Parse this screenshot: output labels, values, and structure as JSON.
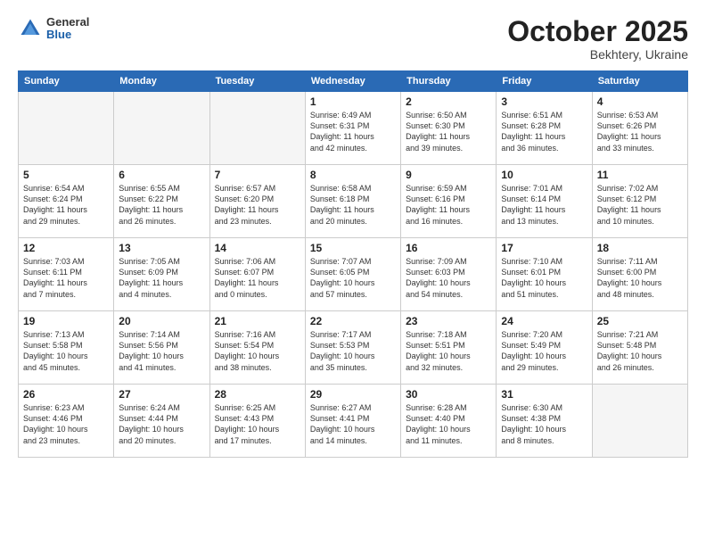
{
  "header": {
    "logo": {
      "general": "General",
      "blue": "Blue"
    },
    "title": "October 2025",
    "location": "Bekhtery, Ukraine"
  },
  "weekdays": [
    "Sunday",
    "Monday",
    "Tuesday",
    "Wednesday",
    "Thursday",
    "Friday",
    "Saturday"
  ],
  "weeks": [
    [
      {
        "day": "",
        "info": ""
      },
      {
        "day": "",
        "info": ""
      },
      {
        "day": "",
        "info": ""
      },
      {
        "day": "1",
        "info": "Sunrise: 6:49 AM\nSunset: 6:31 PM\nDaylight: 11 hours\nand 42 minutes."
      },
      {
        "day": "2",
        "info": "Sunrise: 6:50 AM\nSunset: 6:30 PM\nDaylight: 11 hours\nand 39 minutes."
      },
      {
        "day": "3",
        "info": "Sunrise: 6:51 AM\nSunset: 6:28 PM\nDaylight: 11 hours\nand 36 minutes."
      },
      {
        "day": "4",
        "info": "Sunrise: 6:53 AM\nSunset: 6:26 PM\nDaylight: 11 hours\nand 33 minutes."
      }
    ],
    [
      {
        "day": "5",
        "info": "Sunrise: 6:54 AM\nSunset: 6:24 PM\nDaylight: 11 hours\nand 29 minutes."
      },
      {
        "day": "6",
        "info": "Sunrise: 6:55 AM\nSunset: 6:22 PM\nDaylight: 11 hours\nand 26 minutes."
      },
      {
        "day": "7",
        "info": "Sunrise: 6:57 AM\nSunset: 6:20 PM\nDaylight: 11 hours\nand 23 minutes."
      },
      {
        "day": "8",
        "info": "Sunrise: 6:58 AM\nSunset: 6:18 PM\nDaylight: 11 hours\nand 20 minutes."
      },
      {
        "day": "9",
        "info": "Sunrise: 6:59 AM\nSunset: 6:16 PM\nDaylight: 11 hours\nand 16 minutes."
      },
      {
        "day": "10",
        "info": "Sunrise: 7:01 AM\nSunset: 6:14 PM\nDaylight: 11 hours\nand 13 minutes."
      },
      {
        "day": "11",
        "info": "Sunrise: 7:02 AM\nSunset: 6:12 PM\nDaylight: 11 hours\nand 10 minutes."
      }
    ],
    [
      {
        "day": "12",
        "info": "Sunrise: 7:03 AM\nSunset: 6:11 PM\nDaylight: 11 hours\nand 7 minutes."
      },
      {
        "day": "13",
        "info": "Sunrise: 7:05 AM\nSunset: 6:09 PM\nDaylight: 11 hours\nand 4 minutes."
      },
      {
        "day": "14",
        "info": "Sunrise: 7:06 AM\nSunset: 6:07 PM\nDaylight: 11 hours\nand 0 minutes."
      },
      {
        "day": "15",
        "info": "Sunrise: 7:07 AM\nSunset: 6:05 PM\nDaylight: 10 hours\nand 57 minutes."
      },
      {
        "day": "16",
        "info": "Sunrise: 7:09 AM\nSunset: 6:03 PM\nDaylight: 10 hours\nand 54 minutes."
      },
      {
        "day": "17",
        "info": "Sunrise: 7:10 AM\nSunset: 6:01 PM\nDaylight: 10 hours\nand 51 minutes."
      },
      {
        "day": "18",
        "info": "Sunrise: 7:11 AM\nSunset: 6:00 PM\nDaylight: 10 hours\nand 48 minutes."
      }
    ],
    [
      {
        "day": "19",
        "info": "Sunrise: 7:13 AM\nSunset: 5:58 PM\nDaylight: 10 hours\nand 45 minutes."
      },
      {
        "day": "20",
        "info": "Sunrise: 7:14 AM\nSunset: 5:56 PM\nDaylight: 10 hours\nand 41 minutes."
      },
      {
        "day": "21",
        "info": "Sunrise: 7:16 AM\nSunset: 5:54 PM\nDaylight: 10 hours\nand 38 minutes."
      },
      {
        "day": "22",
        "info": "Sunrise: 7:17 AM\nSunset: 5:53 PM\nDaylight: 10 hours\nand 35 minutes."
      },
      {
        "day": "23",
        "info": "Sunrise: 7:18 AM\nSunset: 5:51 PM\nDaylight: 10 hours\nand 32 minutes."
      },
      {
        "day": "24",
        "info": "Sunrise: 7:20 AM\nSunset: 5:49 PM\nDaylight: 10 hours\nand 29 minutes."
      },
      {
        "day": "25",
        "info": "Sunrise: 7:21 AM\nSunset: 5:48 PM\nDaylight: 10 hours\nand 26 minutes."
      }
    ],
    [
      {
        "day": "26",
        "info": "Sunrise: 6:23 AM\nSunset: 4:46 PM\nDaylight: 10 hours\nand 23 minutes."
      },
      {
        "day": "27",
        "info": "Sunrise: 6:24 AM\nSunset: 4:44 PM\nDaylight: 10 hours\nand 20 minutes."
      },
      {
        "day": "28",
        "info": "Sunrise: 6:25 AM\nSunset: 4:43 PM\nDaylight: 10 hours\nand 17 minutes."
      },
      {
        "day": "29",
        "info": "Sunrise: 6:27 AM\nSunset: 4:41 PM\nDaylight: 10 hours\nand 14 minutes."
      },
      {
        "day": "30",
        "info": "Sunrise: 6:28 AM\nSunset: 4:40 PM\nDaylight: 10 hours\nand 11 minutes."
      },
      {
        "day": "31",
        "info": "Sunrise: 6:30 AM\nSunset: 4:38 PM\nDaylight: 10 hours\nand 8 minutes."
      },
      {
        "day": "",
        "info": ""
      }
    ]
  ]
}
